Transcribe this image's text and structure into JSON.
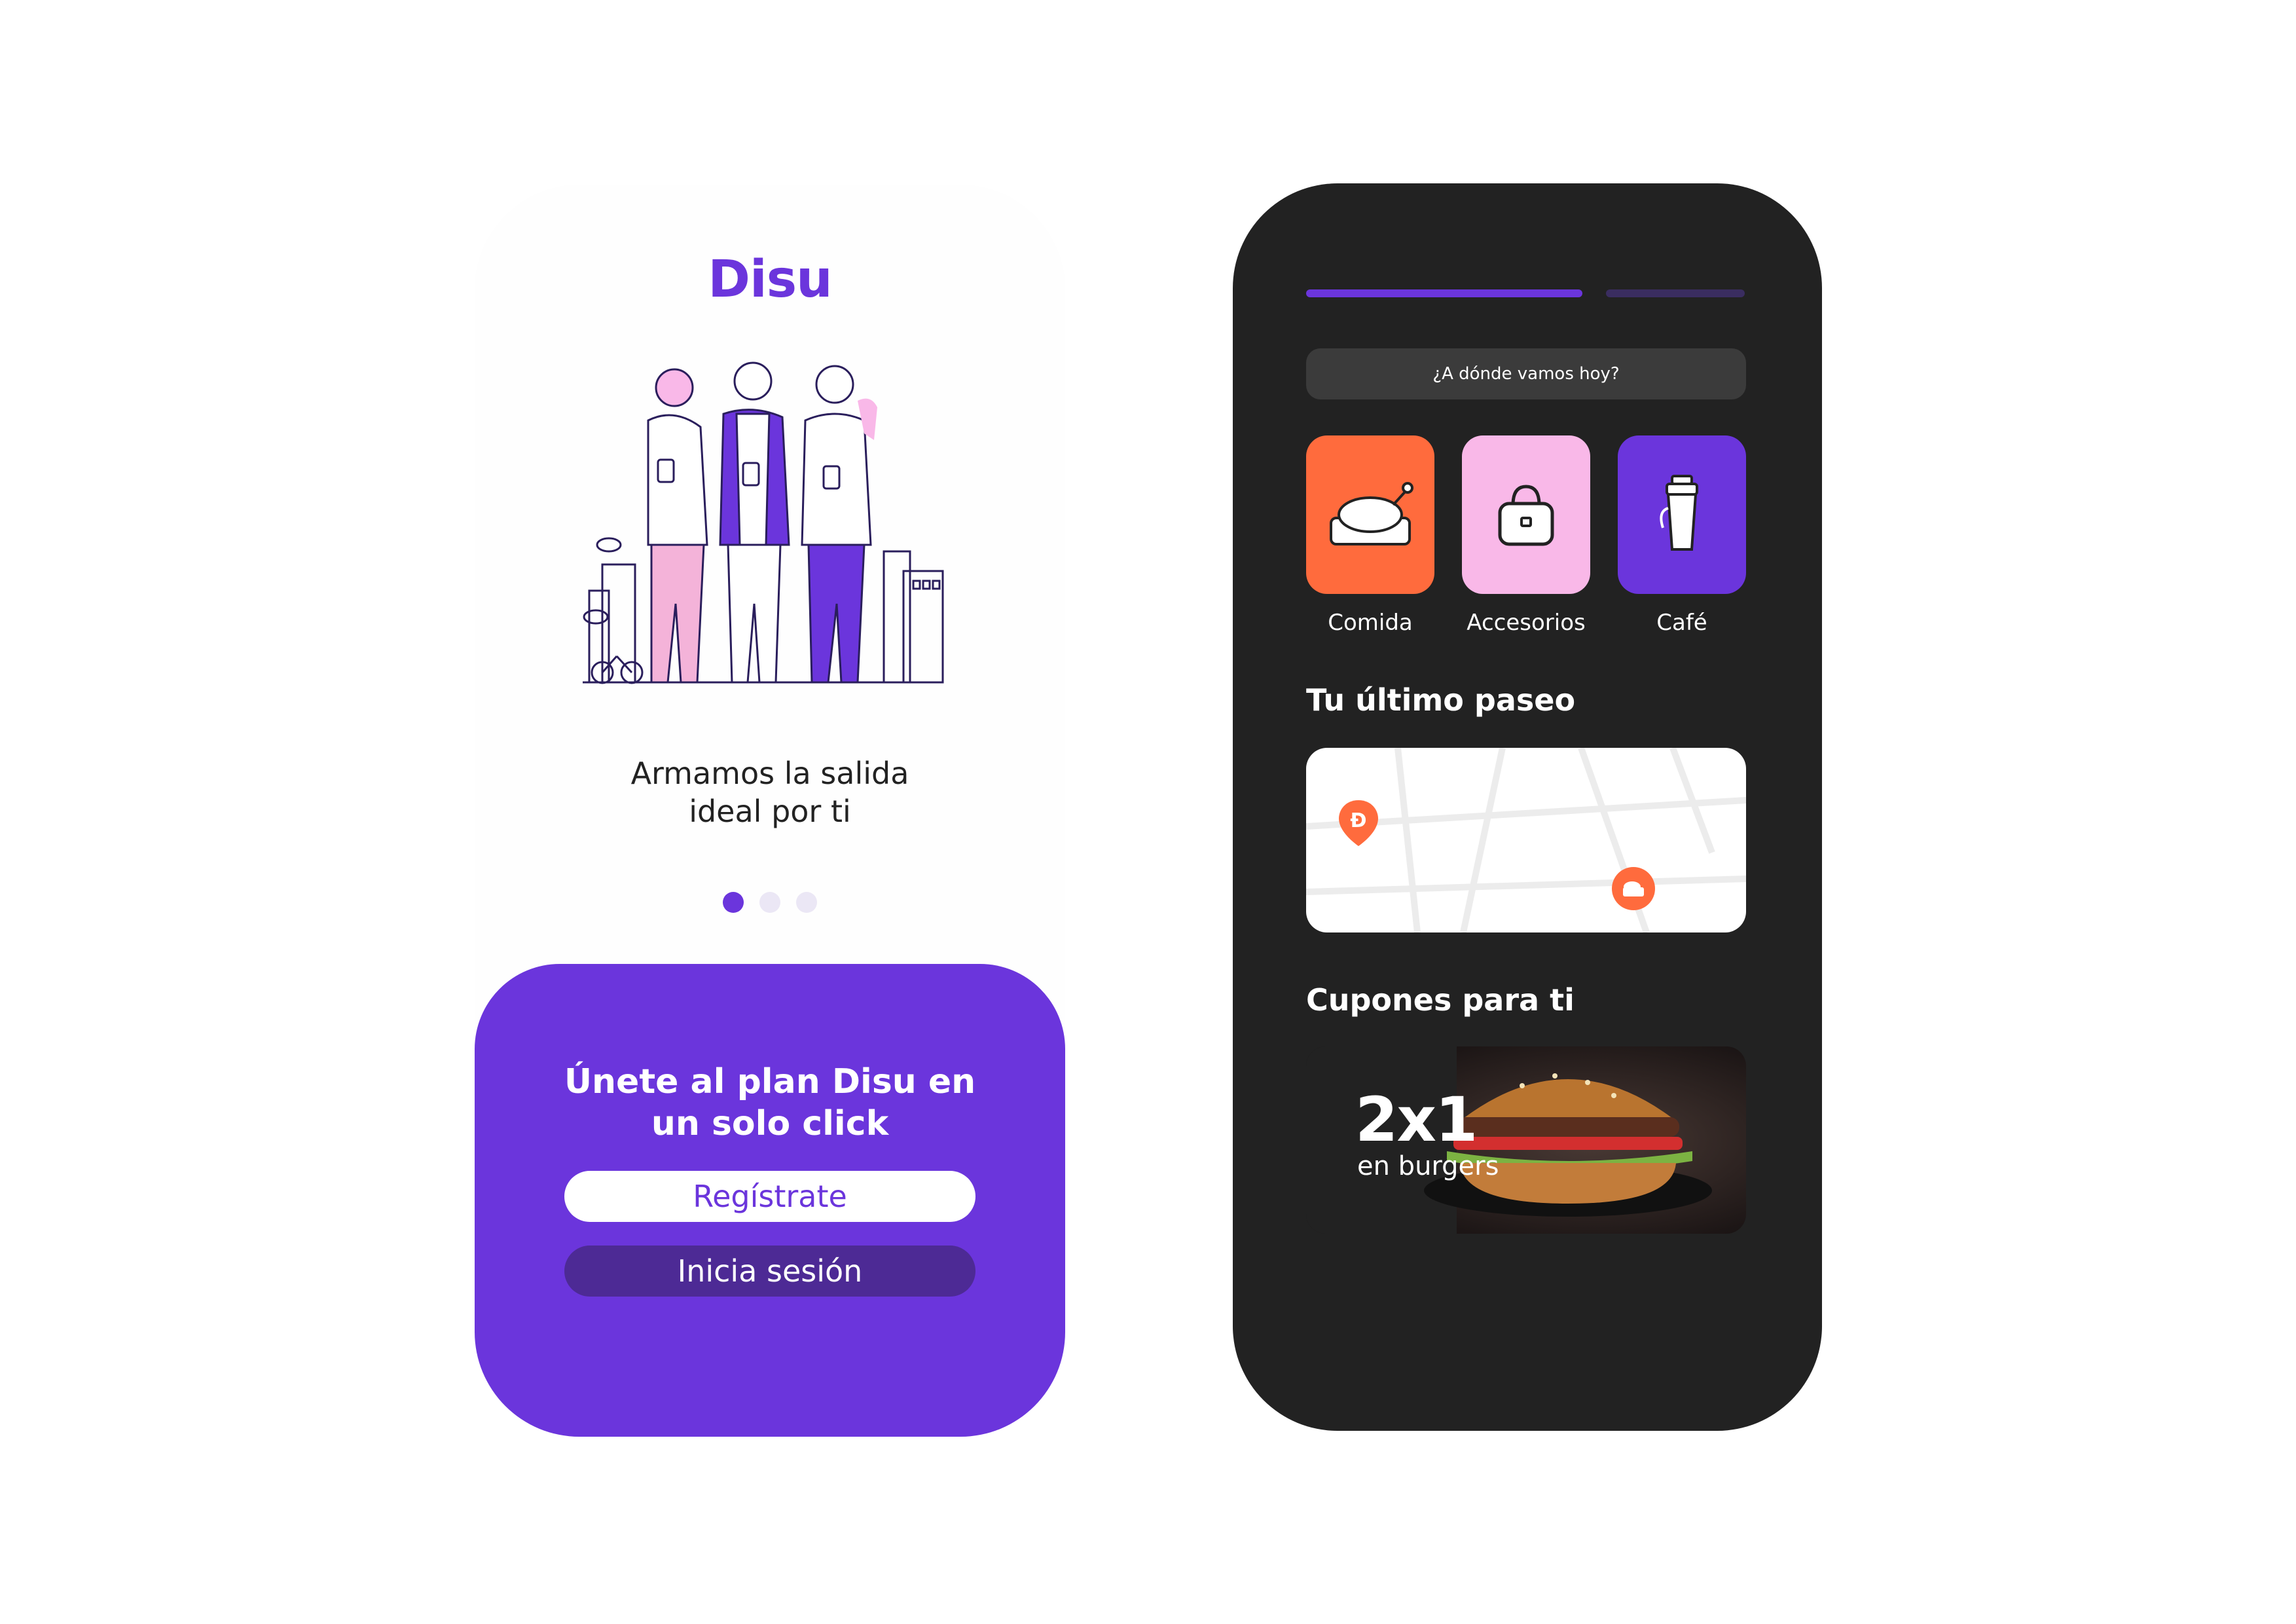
{
  "left_screen": {
    "logo": "Disu",
    "tagline_line1": "Armamos la salida",
    "tagline_line2": "ideal por ti",
    "cta_title_line1": "Únete al plan Disu en",
    "cta_title_line2": "un solo click",
    "register_label": "Regístrate",
    "login_label": "Inicia sesión",
    "carousel_pages": 3,
    "carousel_active": 1
  },
  "right_screen": {
    "search_placeholder": "¿A dónde vamos hoy?",
    "categories": [
      {
        "label": "Comida",
        "icon": "chicken-dish-icon",
        "color": "#ff6b3d"
      },
      {
        "label": "Accesorios",
        "icon": "handbag-icon",
        "color": "#f9b8e8"
      },
      {
        "label": "Café",
        "icon": "coffee-cup-icon",
        "color": "#6b35dc"
      }
    ],
    "last_trip_title": "Tu último paseo",
    "coupons_title": "Cupones para ti",
    "coupon": {
      "headline": "2x1",
      "subline": "en burgers"
    }
  },
  "colors": {
    "brand_purple": "#6b35dc",
    "orange": "#ff6b3d",
    "pink": "#f9b8e8",
    "dark_bg": "#222222"
  }
}
